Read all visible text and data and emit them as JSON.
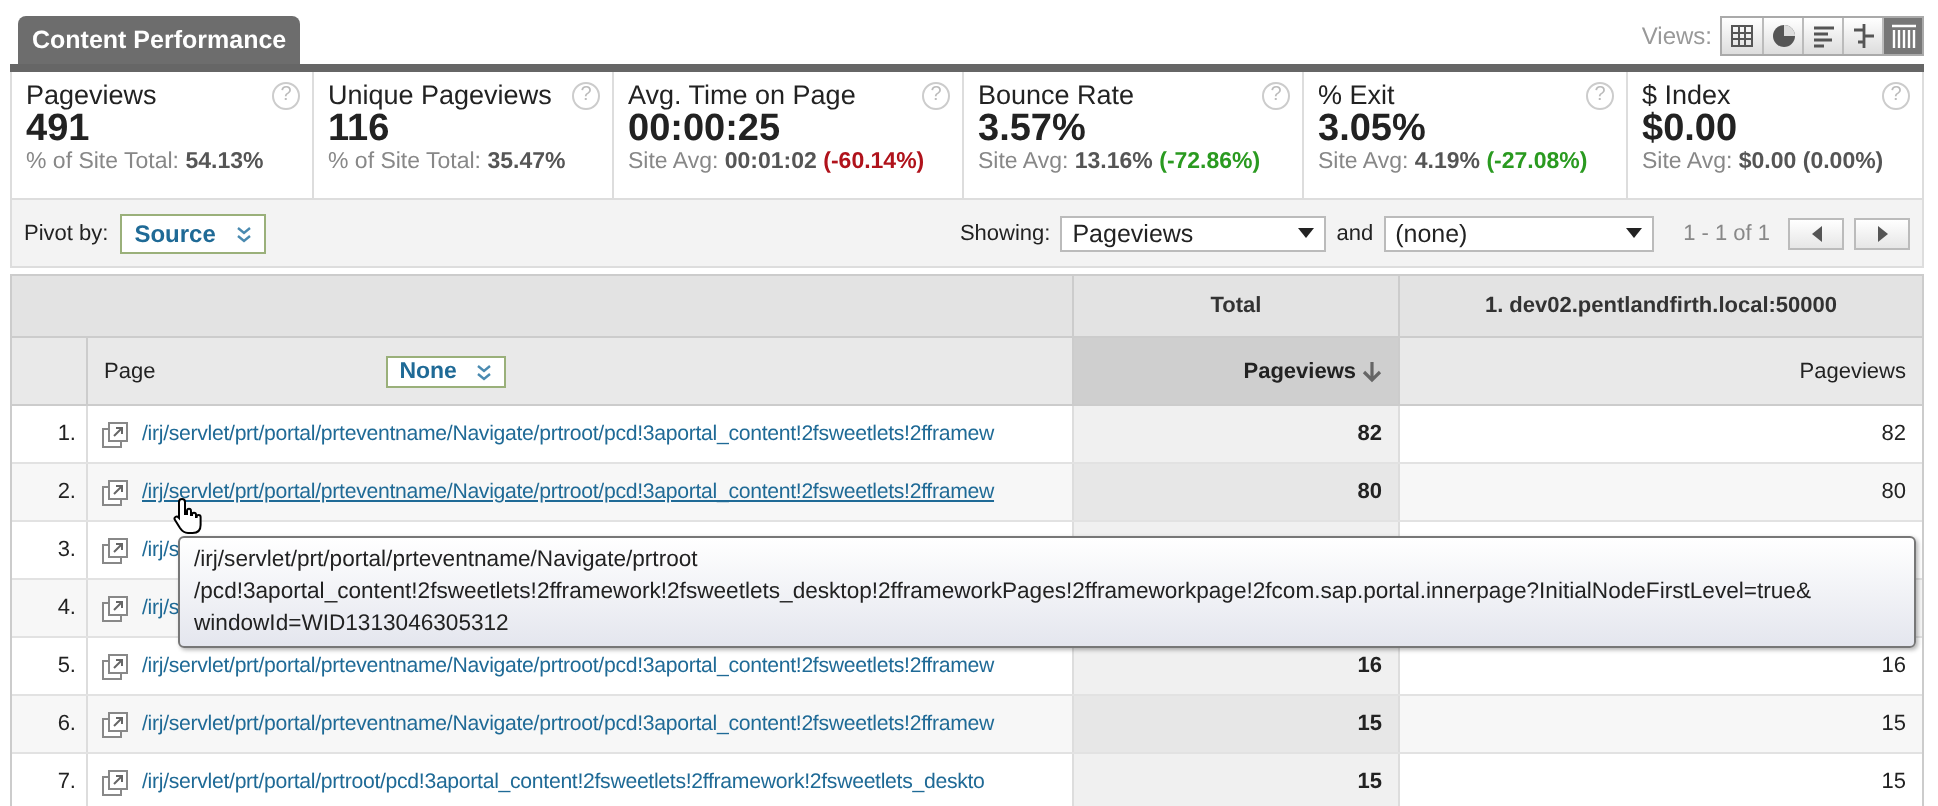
{
  "tab": {
    "label": "Content Performance"
  },
  "views": {
    "label": "Views:",
    "buttons": [
      {
        "kind": "table",
        "selected": false
      },
      {
        "kind": "pie",
        "selected": false
      },
      {
        "kind": "bars",
        "selected": false
      },
      {
        "kind": "compare",
        "selected": false
      },
      {
        "kind": "pivot",
        "selected": true
      }
    ]
  },
  "metrics": [
    {
      "name": "Pageviews",
      "help": "?",
      "value": "491",
      "note_label": "% of Site Total:",
      "note_value": "54.13%"
    },
    {
      "name": "Unique Pageviews",
      "help": "?",
      "value": "116",
      "note_label": "% of Site Total:",
      "note_value": "35.47%"
    },
    {
      "name": "Avg. Time on Page",
      "help": "?",
      "value": "00:00:25",
      "note_label": "Site Avg:",
      "note_value": "00:01:02",
      "change": {
        "text": "(-60.14%)",
        "color": "#b0121b"
      }
    },
    {
      "name": "Bounce Rate",
      "help": "?",
      "value": "3.57%",
      "note_label": "Site Avg:",
      "note_value": "13.16%",
      "change": {
        "text": "(-72.86%)",
        "color": "#2a9a20"
      }
    },
    {
      "name": "% Exit",
      "help": "?",
      "value": "3.05%",
      "note_label": "Site Avg:",
      "note_value": "4.19%",
      "change": {
        "text": "(-27.08%)",
        "color": "#2a9a20"
      }
    },
    {
      "name": "$ Index",
      "help": "?",
      "value": "$0.00",
      "note_label": "Site Avg:",
      "note_value": "$0.00",
      "change": {
        "text": "(0.00%)",
        "color": "#555555"
      }
    }
  ],
  "pivot": {
    "label": "Pivot by:",
    "value": "Source"
  },
  "showing": {
    "label": "Showing:",
    "metric": "Pageviews",
    "joiner": "and",
    "second": "(none)"
  },
  "pagination": {
    "range": "1 - 1 of 1"
  },
  "table": {
    "group_headers": [
      "Total",
      "1. dev02.pentlandfirth.local:50000"
    ],
    "columns": {
      "page": "Page",
      "secondary": "None",
      "total": "Pageviews",
      "total_sorted": true,
      "dev": "Pageviews"
    },
    "rows": [
      {
        "index": "1.",
        "page": "/irj/servlet/prt/portal/prteventname/Navigate/prtroot/pcd!3aportal_content!2fsweetlets!2fframew",
        "hovered": false,
        "total": "82",
        "dev": "82"
      },
      {
        "index": "2.",
        "page": "/irj/servlet/prt/portal/prteventname/Navigate/prtroot/pcd!3aportal_content!2fsweetlets!2fframew",
        "hovered": true,
        "total": "80",
        "dev": "80"
      },
      {
        "index": "3.",
        "page": "/irj/s",
        "hovered": false
      },
      {
        "index": "4.",
        "page": "/irj/s",
        "hovered": false
      },
      {
        "index": "5.",
        "page": "/irj/servlet/prt/portal/prteventname/Navigate/prtroot/pcd!3aportal_content!2fsweetlets!2fframew",
        "hovered": false,
        "total": "16",
        "dev": "16"
      },
      {
        "index": "6.",
        "page": "/irj/servlet/prt/portal/prteventname/Navigate/prtroot/pcd!3aportal_content!2fsweetlets!2fframew",
        "hovered": false,
        "total": "15",
        "dev": "15"
      },
      {
        "index": "7.",
        "page": "/irj/servlet/prt/portal/prtroot/pcd!3aportal_content!2fsweetlets!2fframework!2fsweetlets_deskto",
        "hovered": false,
        "total": "15",
        "dev": "15"
      }
    ]
  },
  "tooltip": {
    "lines": [
      "/irj/servlet/prt/portal/prteventname/Navigate/prtroot",
      "/pcd!3aportal_content!2fsweetlets!2fframework!2fsweetlets_desktop!2fframeworkPages!2fframeworkpage!2fcom.sap.portal.innerpage?InitialNodeFirstLevel=true&",
      "windowId=WID1313046305312"
    ]
  }
}
